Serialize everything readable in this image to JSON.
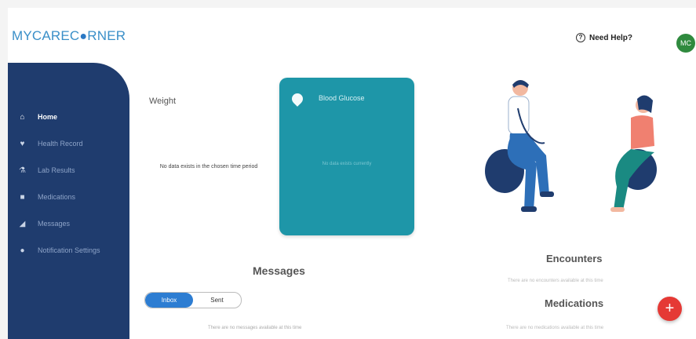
{
  "header": {
    "logo": {
      "pre": "MYCAREC",
      "dot": "●",
      "post": "RNER"
    },
    "help_label": "Need Help?",
    "avatar_initials": "MC"
  },
  "sidebar": {
    "items": [
      {
        "label": "Home",
        "icon": "home-icon",
        "active": true
      },
      {
        "label": "Health Record",
        "icon": "health-record-icon"
      },
      {
        "label": "Lab Results",
        "icon": "lab-results-icon"
      },
      {
        "label": "Medications",
        "icon": "medications-icon"
      },
      {
        "label": "Messages",
        "icon": "messages-icon"
      },
      {
        "label": "Notification Settings",
        "icon": "settings-icon"
      }
    ]
  },
  "weight": {
    "title": "Weight",
    "empty_text": "No data exists in the chosen time period"
  },
  "blood_glucose": {
    "title": "Blood Glucose",
    "empty_text": "No data exists currently"
  },
  "messages": {
    "title": "Messages",
    "tabs": [
      "Inbox",
      "Sent"
    ],
    "empty_text": "There are no messages available at this time"
  },
  "encounters": {
    "title": "Encounters",
    "empty_text": "There are no encounters available at this time"
  },
  "medications": {
    "title": "Medications",
    "empty_text": "There are no medications available at this time"
  },
  "fab_symbol": "+",
  "colors": {
    "brand": "#3a8fc8",
    "sidebar": "#1f3c6e",
    "glucose_card": "#1e96a8",
    "toggle_active": "#2d7dd2",
    "fab": "#e53935",
    "avatar": "#2f8a3e"
  }
}
